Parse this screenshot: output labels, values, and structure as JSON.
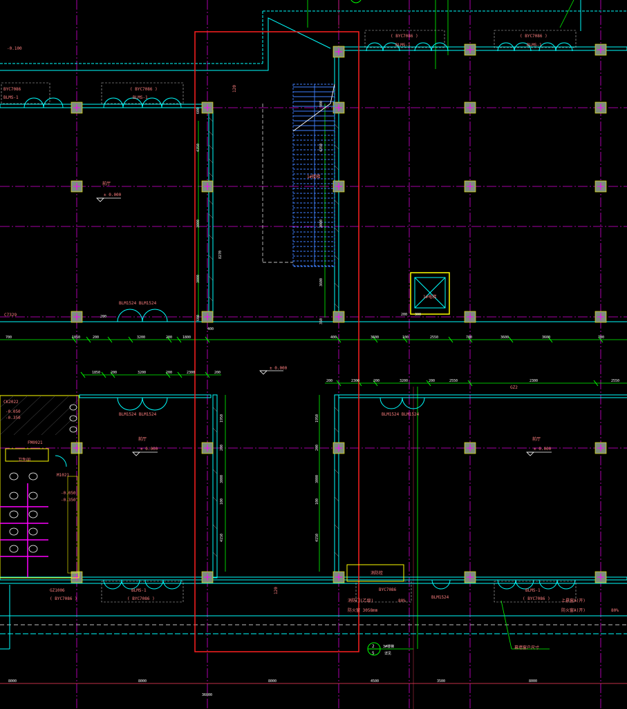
{
  "colors": {
    "background": "#000000",
    "axis": "#ff00ff",
    "wall": "#00ffff",
    "dim": "#00ff00",
    "column": "#7f8c7f",
    "column_mark": "#ff00ff",
    "text": "#ff8080",
    "door": "#00ffff",
    "stair": "#4080ff",
    "highlight": "#ff2020",
    "note": "#ffff00",
    "dashed": "#c0c0c0",
    "grid_outer": "#ff3030"
  },
  "labels": {
    "elev_top_left": "-0.100",
    "elev_hall_left": "± 0.000",
    "elev_center": "± 0.000",
    "elev_low_left": "± 0.000",
    "elev_low_right": "± 0.000",
    "room_hall_left": "前厅",
    "room_low_left": "前厅",
    "room_low_right": "前厅",
    "stair_name": "1#楼梯",
    "elevator_name": "1#电梯",
    "toilet_name": "卫生间",
    "toilet_elev_a": "-0.050",
    "toilet_elev_b": "-0.350",
    "toilet_elev_c": "-0.050",
    "toilet_elev_d": "-0.350",
    "window_ck": "CK2022",
    "door_fm": "FM0921",
    "door_m": "M1021",
    "window_gz": "GZ1006",
    "window_gz_b": "( BYC7086 )",
    "window_gz2": "GZ2",
    "door_c7329": "C7329",
    "fire_door_label": "消防栓",
    "fire_note_a": "BYC7086",
    "fire_note_b": "消防门(乙级)",
    "fire_note_c": "防火窗 3058mm",
    "fire_note_pct": "80%",
    "fire_note_pct2": "80%",
    "window_rb_a": "BLMS-1",
    "window_rb_b": "( BYC7086 )",
    "window_rb_c": "上悬窗A(开)",
    "window_rb_d": "防火窗A(开)",
    "window_rb_note": "幕墙窗户尺寸",
    "blm_tl_a": "BYC7086",
    "blm_tl_b": "BLMS-1",
    "blm_tl2_a": "( BYC7086 )",
    "blm_tl2_b": "BLMS-1",
    "blm_tr1_a": "( BYC7086 )",
    "blm_tr1_b": "BLMS-1",
    "blm_tr2_a": "( BYC7086 )",
    "blm_tr2_b": "BLMS-1",
    "blm_mid_left": "BLM1524  BLM1524",
    "blm_low_left": "BLM1524  BLM1524",
    "blm_low_right": "BLM1524  BLM1524",
    "blm_bottom_a": "BLMS-1",
    "blm_bottom_b": "( BYC7086 )",
    "blm_bottom_right": "BLM1524",
    "blm_bottom_right_b": "BYC7086",
    "section_mark_num": "2",
    "section_mark_den": "5",
    "section_mark_note": "3#楼梯",
    "section_mark_sub": "详见",
    "level_120_a": "120",
    "level_120_b": "120"
  },
  "dims": {
    "bottom_axes": [
      "8000",
      "8000",
      "8000",
      "4500",
      "3500",
      "8000"
    ],
    "bottom_total": "36000",
    "mid_row_left": [
      "700",
      "1850",
      "200",
      "3200",
      "200",
      "1800"
    ],
    "mid_row_right": [
      "400",
      "3600",
      "100",
      "2550",
      "700",
      "3600",
      "3600",
      "700"
    ],
    "low_row_left": [
      "1850",
      "200",
      "3200",
      "200",
      "2300",
      "200"
    ],
    "low_row_right": [
      "200",
      "2300",
      "200",
      "3200",
      "200",
      "2550",
      "2300",
      "2550"
    ],
    "vert_left_upper": [
      "600",
      "4350",
      "3000",
      "3000",
      "600"
    ],
    "vert_left_total": "8270",
    "vert_center_upper": [
      "900",
      "4350",
      "3000",
      "3600",
      "350"
    ],
    "vert_left_lower": [
      "1950",
      "200",
      "3000",
      "100",
      "4150"
    ],
    "vert_right_lower": [
      "1950",
      "200",
      "3000",
      "100",
      "4150"
    ],
    "side_small": [
      "400",
      "200",
      "200",
      "300"
    ]
  }
}
